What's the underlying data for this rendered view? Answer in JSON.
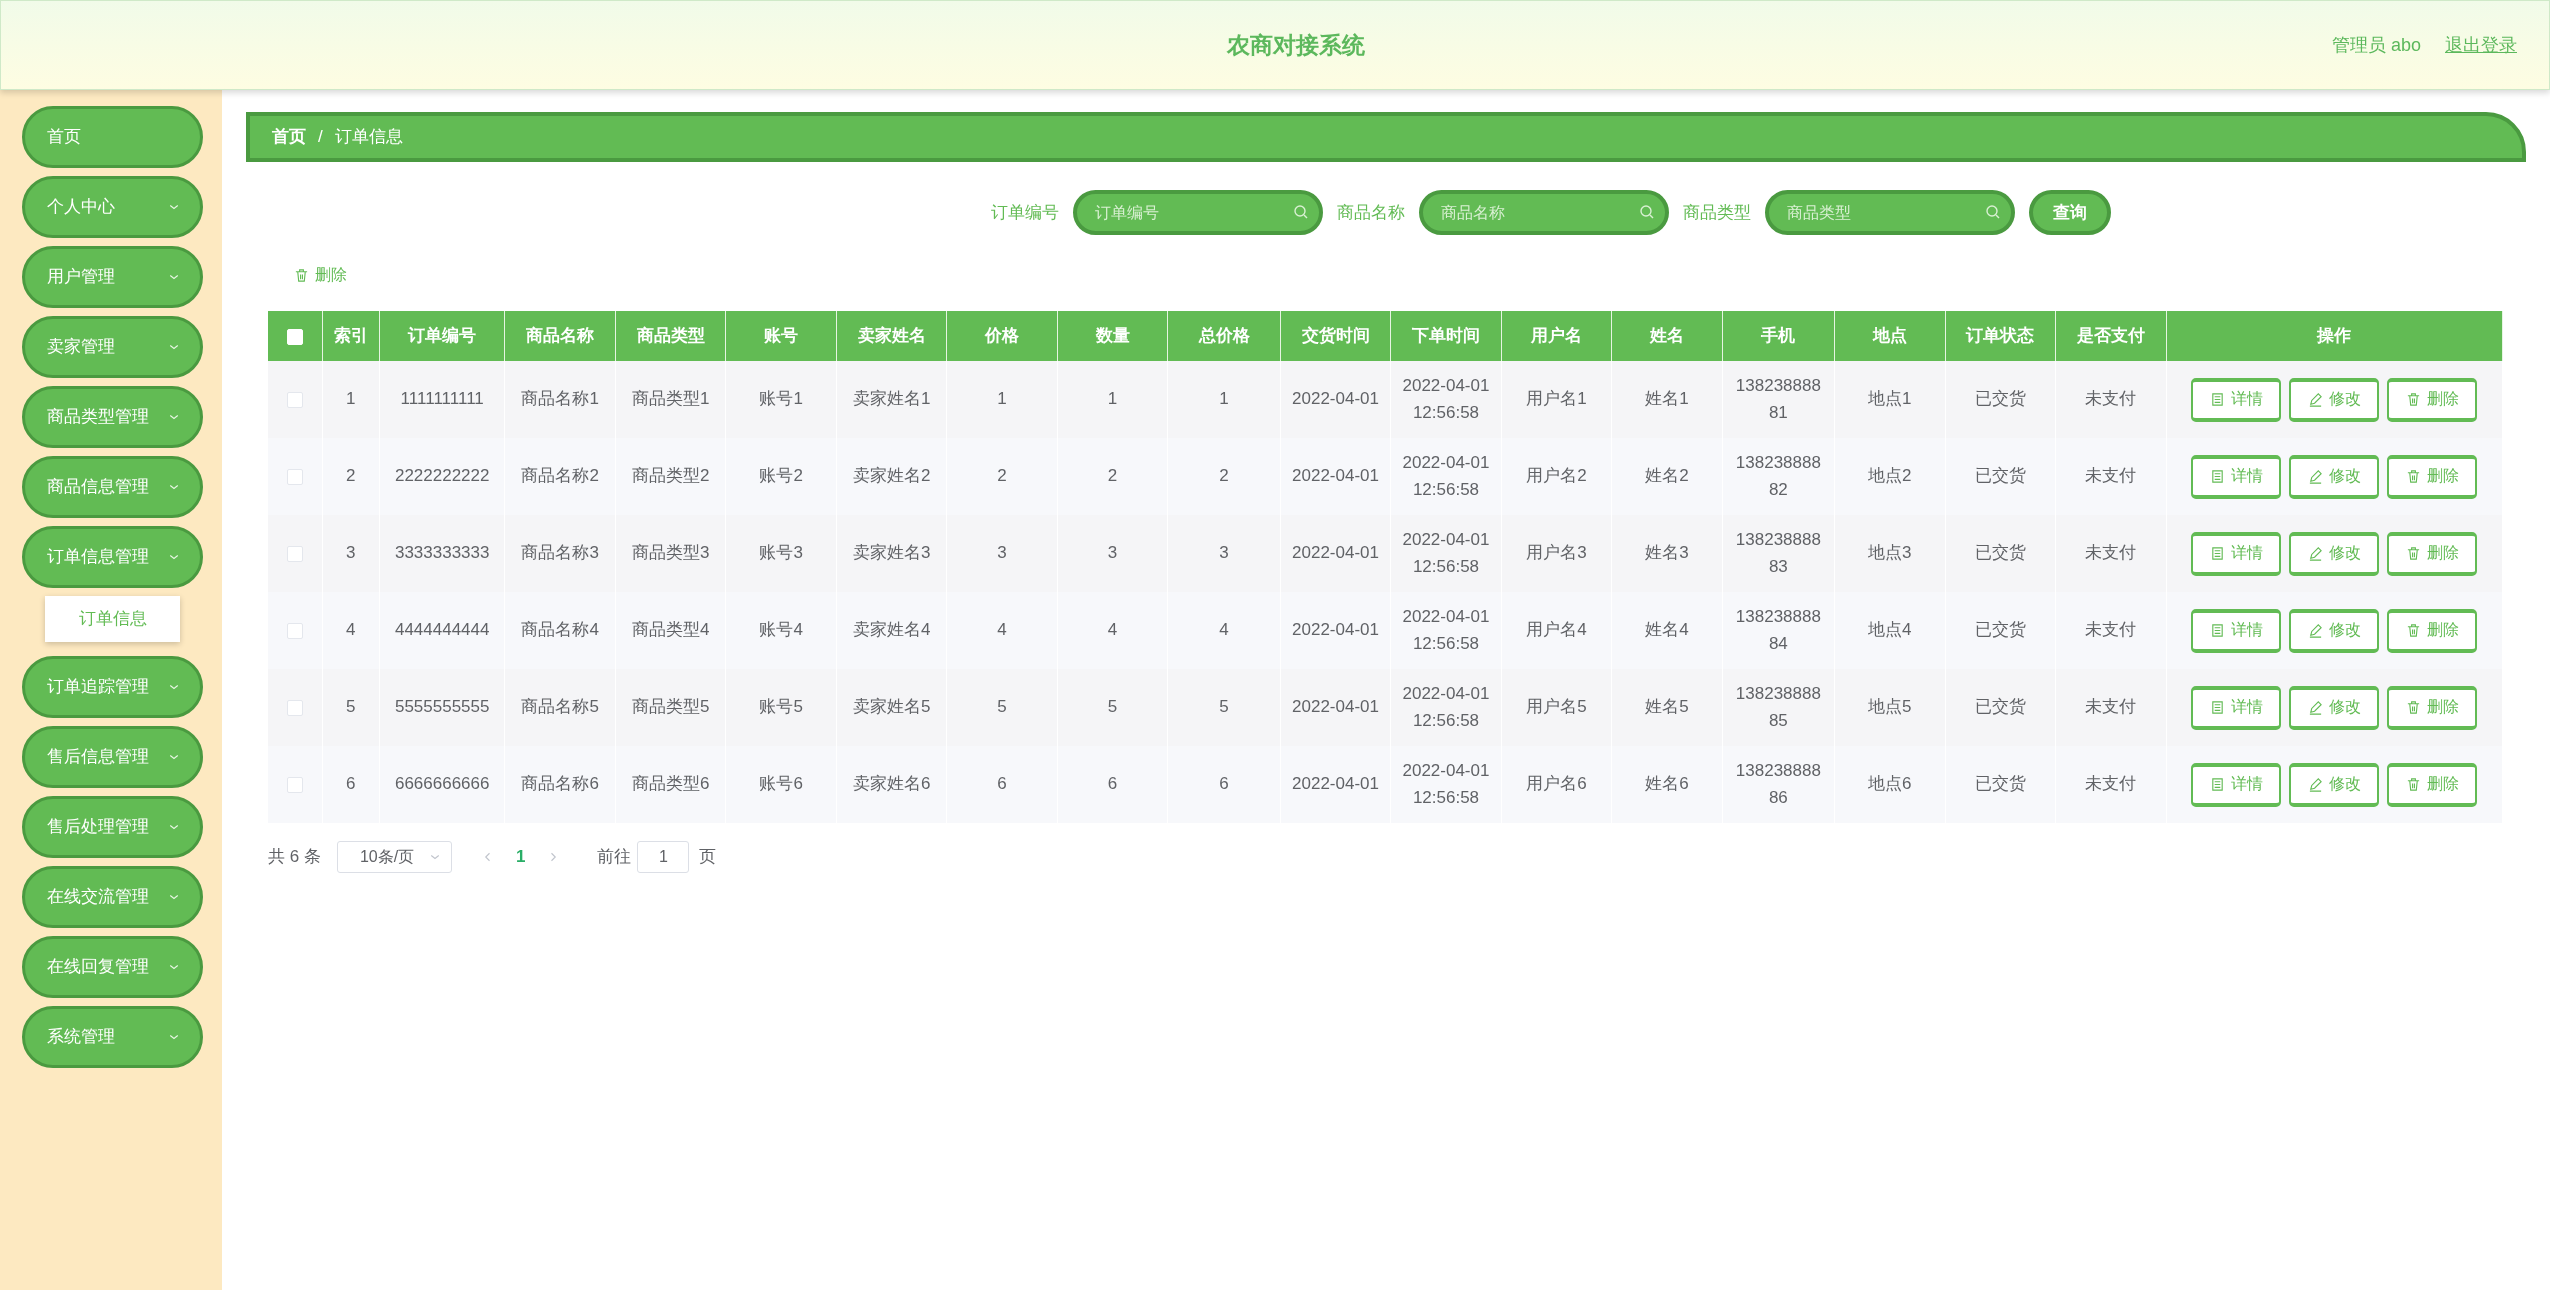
{
  "header": {
    "title": "农商对接系统",
    "user": "管理员 abo",
    "logout": "退出登录"
  },
  "sidebar": {
    "items": [
      {
        "label": "首页",
        "kind": "link"
      },
      {
        "label": "个人中心",
        "kind": "menu"
      },
      {
        "label": "用户管理",
        "kind": "menu"
      },
      {
        "label": "卖家管理",
        "kind": "menu"
      },
      {
        "label": "商品类型管理",
        "kind": "menu"
      },
      {
        "label": "商品信息管理",
        "kind": "menu"
      },
      {
        "label": "订单信息管理",
        "kind": "menu",
        "children": [
          {
            "label": "订单信息",
            "selected": true
          }
        ]
      },
      {
        "label": "订单追踪管理",
        "kind": "menu"
      },
      {
        "label": "售后信息管理",
        "kind": "menu"
      },
      {
        "label": "售后处理管理",
        "kind": "menu"
      },
      {
        "label": "在线交流管理",
        "kind": "menu"
      },
      {
        "label": "在线回复管理",
        "kind": "menu"
      },
      {
        "label": "系统管理",
        "kind": "menu"
      }
    ]
  },
  "breadcrumb": {
    "items": [
      "首页",
      "订单信息"
    ],
    "separator": "/"
  },
  "search": {
    "fields": [
      {
        "label": "订单编号",
        "placeholder": "订单编号"
      },
      {
        "label": "商品名称",
        "placeholder": "商品名称"
      },
      {
        "label": "商品类型",
        "placeholder": "商品类型"
      }
    ],
    "button": "查询"
  },
  "toolbar": {
    "delete": "删除"
  },
  "table": {
    "select_all": {
      "checked": false
    },
    "columns": [
      "索引",
      "订单编号",
      "商品名称",
      "商品类型",
      "账号",
      "卖家姓名",
      "价格",
      "数量",
      "总价格",
      "交货时间",
      "下单时间",
      "用户名",
      "姓名",
      "手机",
      "地点",
      "订单状态",
      "是否支付",
      "操作"
    ],
    "rows": [
      {
        "checked": false,
        "cells": [
          "1",
          "1111111111",
          "商品名称1",
          "商品类型1",
          "账号1",
          "卖家姓名1",
          "1",
          "1",
          "1",
          "2022-04-01",
          "2022-04-01 12:56:58",
          "用户名1",
          "姓名1",
          "13823888881",
          "地点1",
          "已交货",
          "未支付"
        ],
        "actions": [
          "详情",
          "修改",
          "删除"
        ]
      },
      {
        "checked": false,
        "cells": [
          "2",
          "2222222222",
          "商品名称2",
          "商品类型2",
          "账号2",
          "卖家姓名2",
          "2",
          "2",
          "2",
          "2022-04-01",
          "2022-04-01 12:56:58",
          "用户名2",
          "姓名2",
          "13823888882",
          "地点2",
          "已交货",
          "未支付"
        ],
        "actions": [
          "详情",
          "修改",
          "删除"
        ]
      },
      {
        "checked": false,
        "cells": [
          "3",
          "3333333333",
          "商品名称3",
          "商品类型3",
          "账号3",
          "卖家姓名3",
          "3",
          "3",
          "3",
          "2022-04-01",
          "2022-04-01 12:56:58",
          "用户名3",
          "姓名3",
          "13823888883",
          "地点3",
          "已交货",
          "未支付"
        ],
        "actions": [
          "详情",
          "修改",
          "删除"
        ]
      },
      {
        "checked": false,
        "cells": [
          "4",
          "4444444444",
          "商品名称4",
          "商品类型4",
          "账号4",
          "卖家姓名4",
          "4",
          "4",
          "4",
          "2022-04-01",
          "2022-04-01 12:56:58",
          "用户名4",
          "姓名4",
          "13823888884",
          "地点4",
          "已交货",
          "未支付"
        ],
        "actions": [
          "详情",
          "修改",
          "删除"
        ]
      },
      {
        "checked": false,
        "cells": [
          "5",
          "5555555555",
          "商品名称5",
          "商品类型5",
          "账号5",
          "卖家姓名5",
          "5",
          "5",
          "5",
          "2022-04-01",
          "2022-04-01 12:56:58",
          "用户名5",
          "姓名5",
          "13823888885",
          "地点5",
          "已交货",
          "未支付"
        ],
        "actions": [
          "详情",
          "修改",
          "删除"
        ]
      },
      {
        "checked": false,
        "cells": [
          "6",
          "6666666666",
          "商品名称6",
          "商品类型6",
          "账号6",
          "卖家姓名6",
          "6",
          "6",
          "6",
          "2022-04-01",
          "2022-04-01 12:56:58",
          "用户名6",
          "姓名6",
          "13823888886",
          "地点6",
          "已交货",
          "未支付"
        ],
        "actions": [
          "详情",
          "修改",
          "删除"
        ]
      }
    ]
  },
  "pagination": {
    "total": "共 6 条",
    "page_size": "10条/页",
    "pages": [
      {
        "label": "1",
        "selected": true
      }
    ],
    "goto_label": "前往",
    "goto_value": "1",
    "goto_suffix": "页"
  }
}
